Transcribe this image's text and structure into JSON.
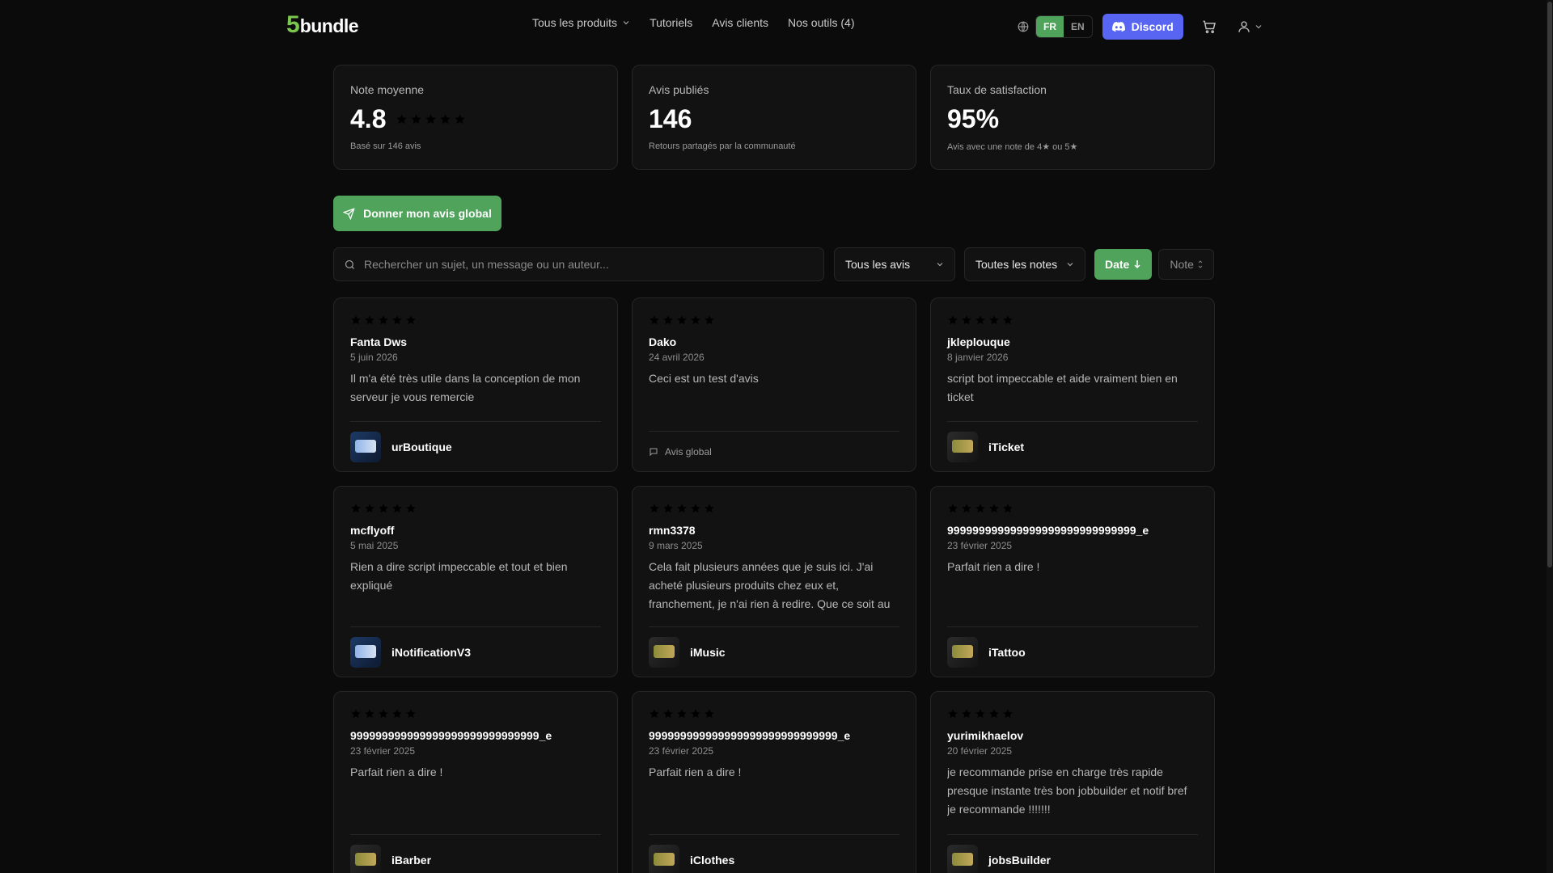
{
  "brand": {
    "digit": "5",
    "word": "bundle",
    "accent": "#7bc74d"
  },
  "nav": {
    "items": [
      {
        "label": "Tous les produits",
        "has_chevron": true
      },
      {
        "label": "Tutoriels"
      },
      {
        "label": "Avis clients"
      },
      {
        "label": "Nos outils (4)"
      }
    ]
  },
  "tools": {
    "globe_icon": "globe-icon",
    "lang_fr": "FR",
    "lang_en": "EN",
    "discord_label": "Discord",
    "cart_icon": "cart-icon",
    "user_icon": "user-icon"
  },
  "stats": [
    {
      "label": "Note moyenne",
      "value": "4.8",
      "stars": 5,
      "sub": "Basé sur 146 avis"
    },
    {
      "label": "Avis publiés",
      "value": "146",
      "sub": "Retours partagés par la communauté"
    },
    {
      "label": "Taux de satisfaction",
      "value": "95%",
      "sub": "Avis avec une note de 4★ ou 5★"
    }
  ],
  "cta": {
    "label": "Donner mon avis global"
  },
  "filters": {
    "search_placeholder": "Rechercher un sujet, un message ou un auteur...",
    "type_select": "Tous les avis",
    "note_select": "Toutes les notes",
    "sort_date": "Date",
    "sort_note": "Note"
  },
  "reviews": [
    {
      "rating": 5,
      "author": "Fanta Dws",
      "date": "5 juin 2026",
      "message": "Il m'a été très utile dans la conception de mon serveur je vous remercie",
      "product": "urBoutique"
    },
    {
      "rating": 5,
      "author": "Dako",
      "date": "24 avril 2026",
      "message": "Ceci est un test d'avis",
      "global_label": "Avis global"
    },
    {
      "rating": 5,
      "author": "jkleplouque",
      "date": "8 janvier 2026",
      "message": "script bot impeccable et aide vraiment bien en ticket",
      "product": "iTicket"
    },
    {
      "rating": 5,
      "author": "mcflyoff",
      "date": "5 mai 2025",
      "message": "Rien a dire script impeccable et tout et bien expliqué",
      "product": "iNotificationV3"
    },
    {
      "rating": 5,
      "author": "rmn3378",
      "date": "9 mars 2025",
      "message": "Cela fait plusieurs années que je suis ici. J'ai acheté plusieurs produits chez eux et, franchement, je n'ai rien à redire. Que ce soit au niveau du script ou du...",
      "product": "iMusic"
    },
    {
      "rating": 5,
      "author": "999999999999999999999999999999_e",
      "date": "23 février 2025",
      "message": "Parfait rien a dire !",
      "product": "iTattoo"
    },
    {
      "rating": 5,
      "author": "999999999999999999999999999999_e",
      "date": "23 février 2025",
      "message": "Parfait rien a dire !",
      "product": "iBarber"
    },
    {
      "rating": 5,
      "author": "999999999999999999999999999999_e",
      "date": "23 février 2025",
      "message": "Parfait rien a dire !",
      "product": "iClothes"
    },
    {
      "rating": 5,
      "author": "yurimikhaelov",
      "date": "20 février 2025",
      "message": "je recommande prise en charge très rapide presque instante très bon jobbuilder et notif bref je recommande !!!!!!!",
      "product": "jobsBuilder"
    }
  ],
  "colors": {
    "green": "#4fa35a",
    "discord": "#5865f2",
    "star": "#f5b400",
    "card_bg": "#121212",
    "border": "#262626"
  }
}
